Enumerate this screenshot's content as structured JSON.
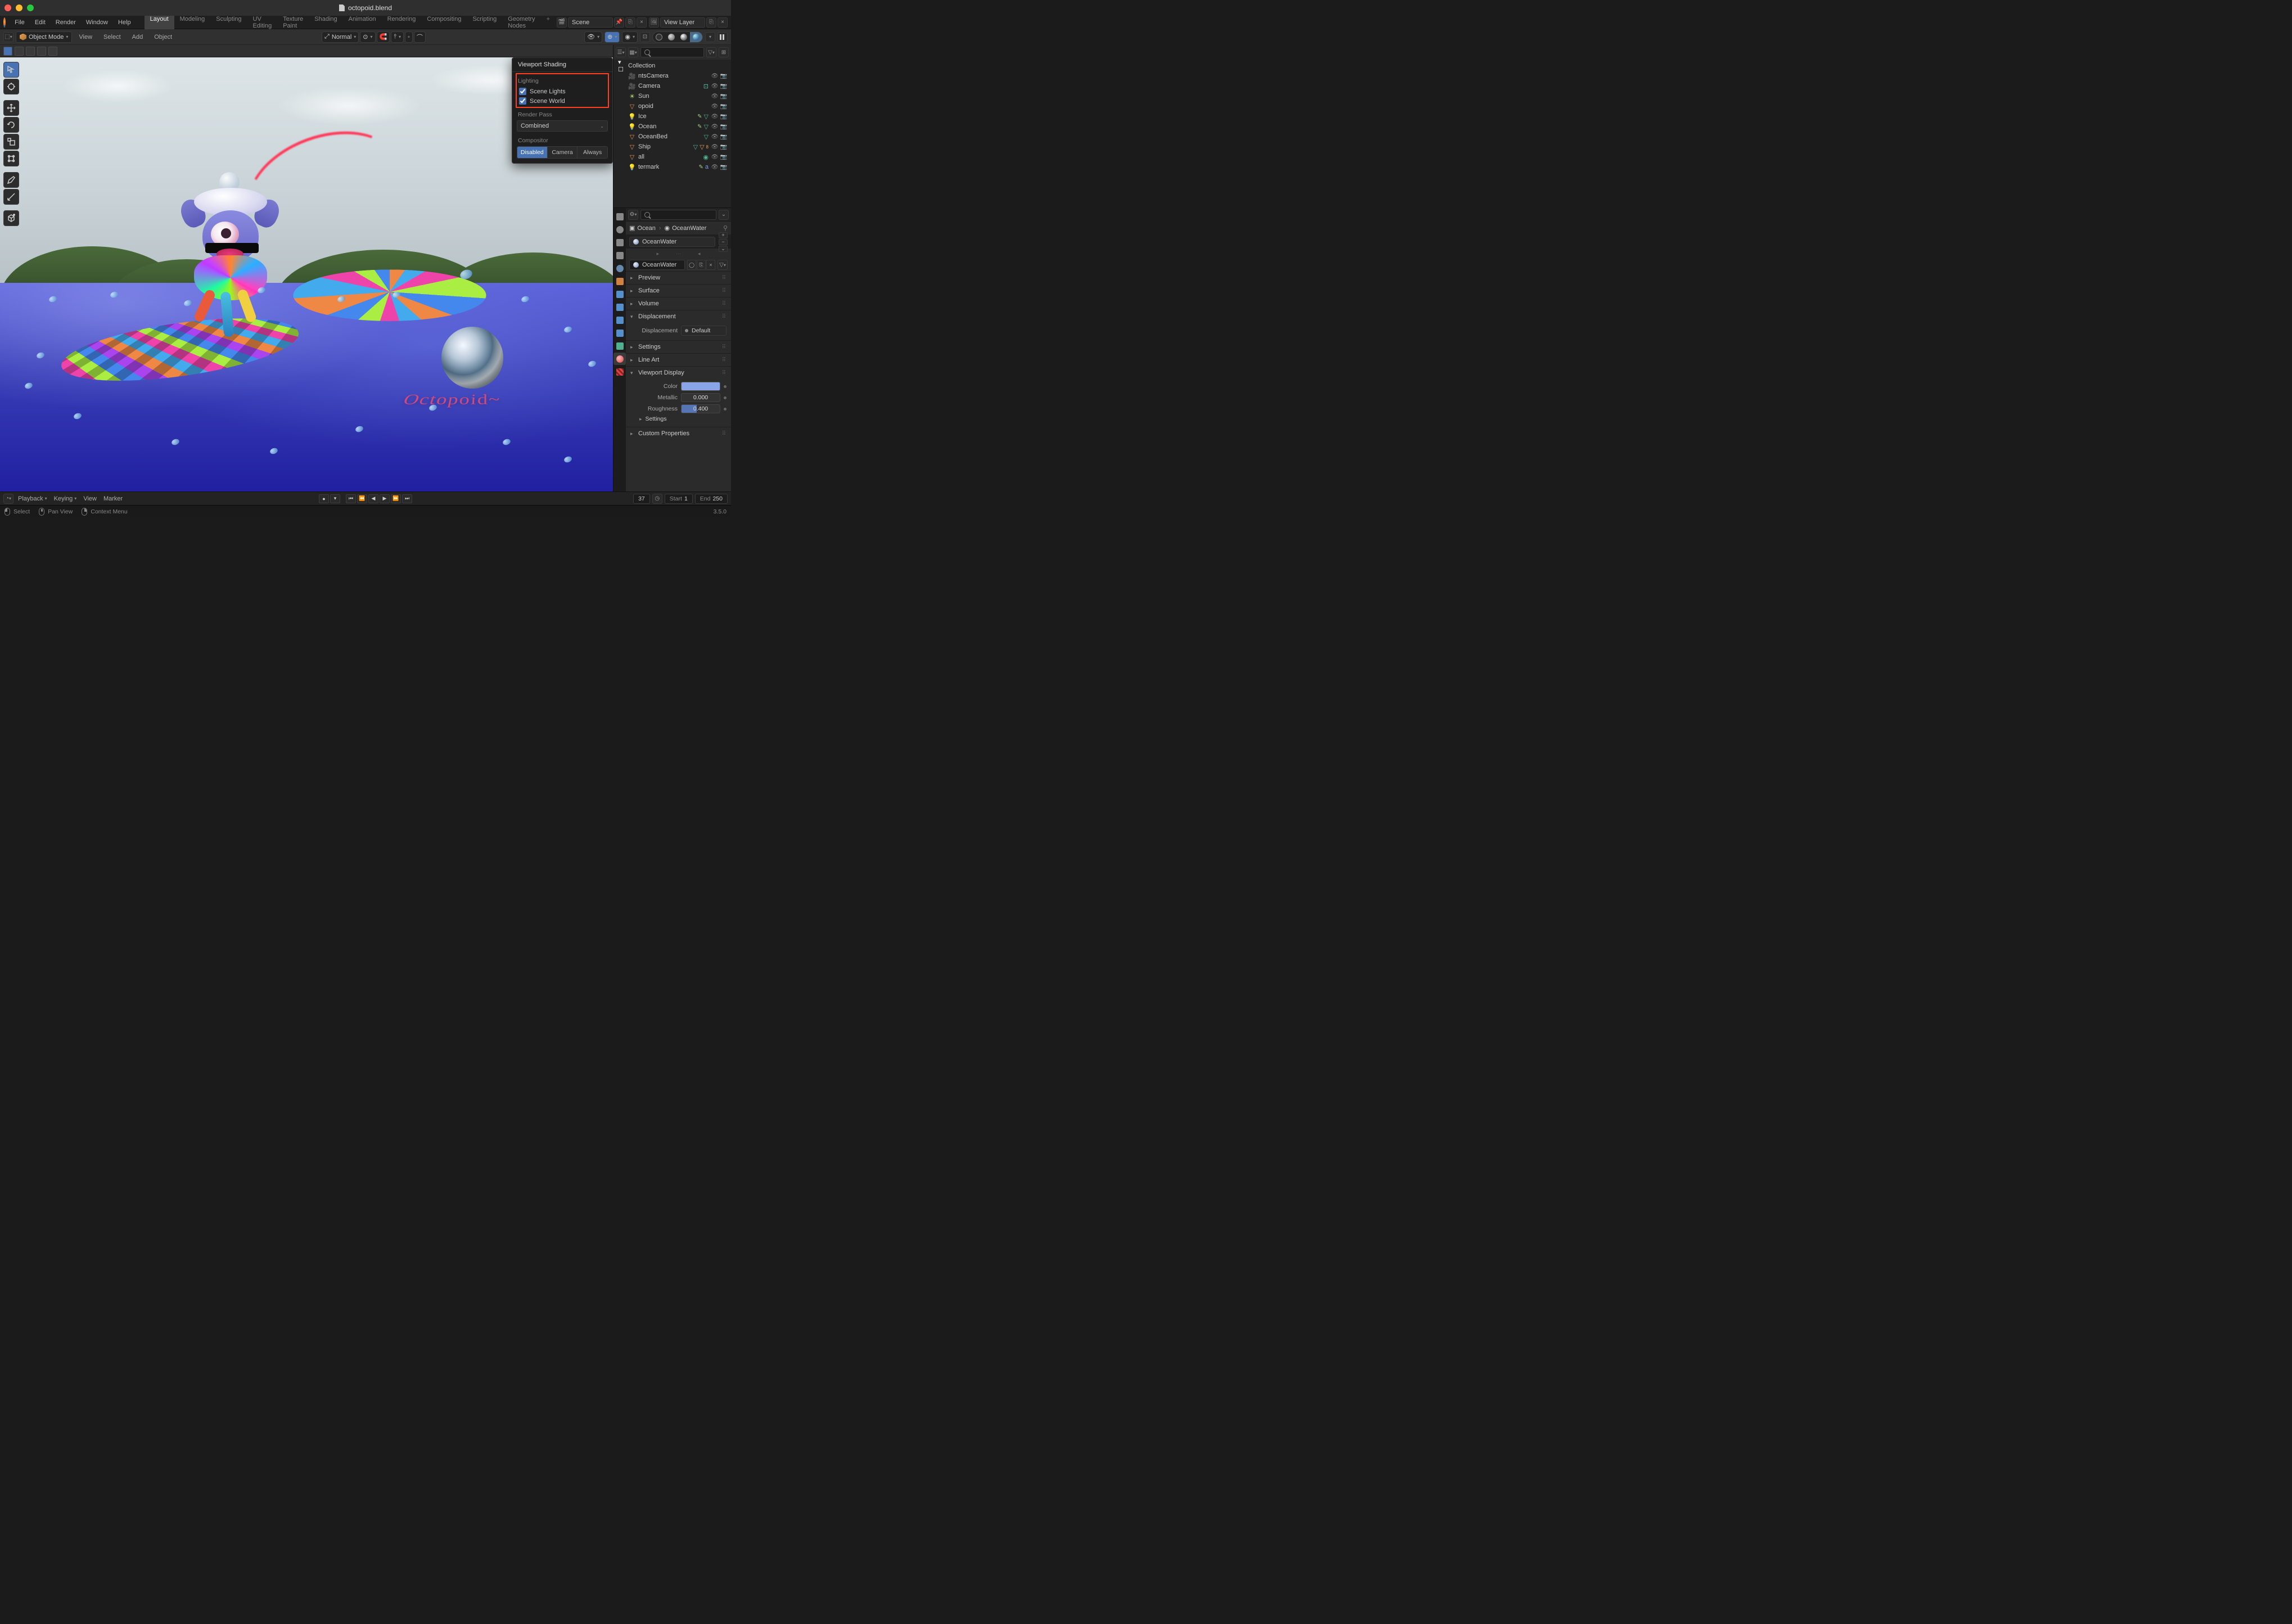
{
  "window": {
    "title": "octopoid.blend"
  },
  "menubar": {
    "items": [
      "File",
      "Edit",
      "Render",
      "Window",
      "Help"
    ]
  },
  "workspaces": {
    "tabs": [
      "Layout",
      "Modeling",
      "Sculpting",
      "UV Editing",
      "Texture Paint",
      "Shading",
      "Animation",
      "Rendering",
      "Compositing",
      "Scripting",
      "Geometry Nodes"
    ],
    "active": "Layout"
  },
  "scene": {
    "name": "Scene"
  },
  "view_layer": {
    "name": "View Layer"
  },
  "tool_header": {
    "mode": "Object Mode",
    "menus": [
      "View",
      "Select",
      "Add",
      "Object"
    ],
    "orientation": "Normal"
  },
  "viewport": {
    "watermark_text": "Octopoid~"
  },
  "shading_popover": {
    "title": "Viewport Shading",
    "lighting_label": "Lighting",
    "scene_lights_label": "Scene Lights",
    "scene_lights_checked": true,
    "scene_world_label": "Scene World",
    "scene_world_checked": true,
    "render_pass_label": "Render Pass",
    "render_pass_value": "Combined",
    "compositor_label": "Compositor",
    "compositor_options": [
      "Disabled",
      "Camera",
      "Always"
    ],
    "compositor_active": "Disabled"
  },
  "outliner": {
    "collection": "Collection",
    "items": [
      {
        "name": "ntsCamera",
        "type": "camera"
      },
      {
        "name": "Camera",
        "type": "camera"
      },
      {
        "name": "Sun",
        "type": "sun"
      },
      {
        "name": "opoid",
        "type": "mesh"
      },
      {
        "name": "Ice",
        "type": "light"
      },
      {
        "name": "Ocean",
        "type": "light"
      },
      {
        "name": "OceanBed",
        "type": "mesh"
      },
      {
        "name": "Ship",
        "type": "mesh"
      },
      {
        "name": "all",
        "type": "mesh"
      },
      {
        "name": "termark",
        "type": "light"
      }
    ]
  },
  "properties": {
    "breadcrumb": {
      "object": "Ocean",
      "material": "OceanWater"
    },
    "material_name": "OceanWater",
    "link_name": "OceanWater",
    "panels": {
      "preview": "Preview",
      "surface": "Surface",
      "volume": "Volume",
      "displacement": "Displacement",
      "displacement_label": "Displacement",
      "displacement_value": "Default",
      "settings": "Settings",
      "lineart": "Line Art",
      "viewport_display": "Viewport Display",
      "color_label": "Color",
      "color_value": "#8aa4e8",
      "metallic_label": "Metallic",
      "metallic_value": "0.000",
      "roughness_label": "Roughness",
      "roughness_value": "0.400",
      "vd_settings": "Settings",
      "custom_props": "Custom Properties"
    }
  },
  "timeline": {
    "menus": [
      "Playback",
      "Keying",
      "View",
      "Marker"
    ],
    "current_frame": "37",
    "start_label": "Start",
    "start": "1",
    "end_label": "End",
    "end": "250"
  },
  "statusbar": {
    "select": "Select",
    "pan": "Pan View",
    "context": "Context Menu",
    "version": "3.5.0"
  }
}
